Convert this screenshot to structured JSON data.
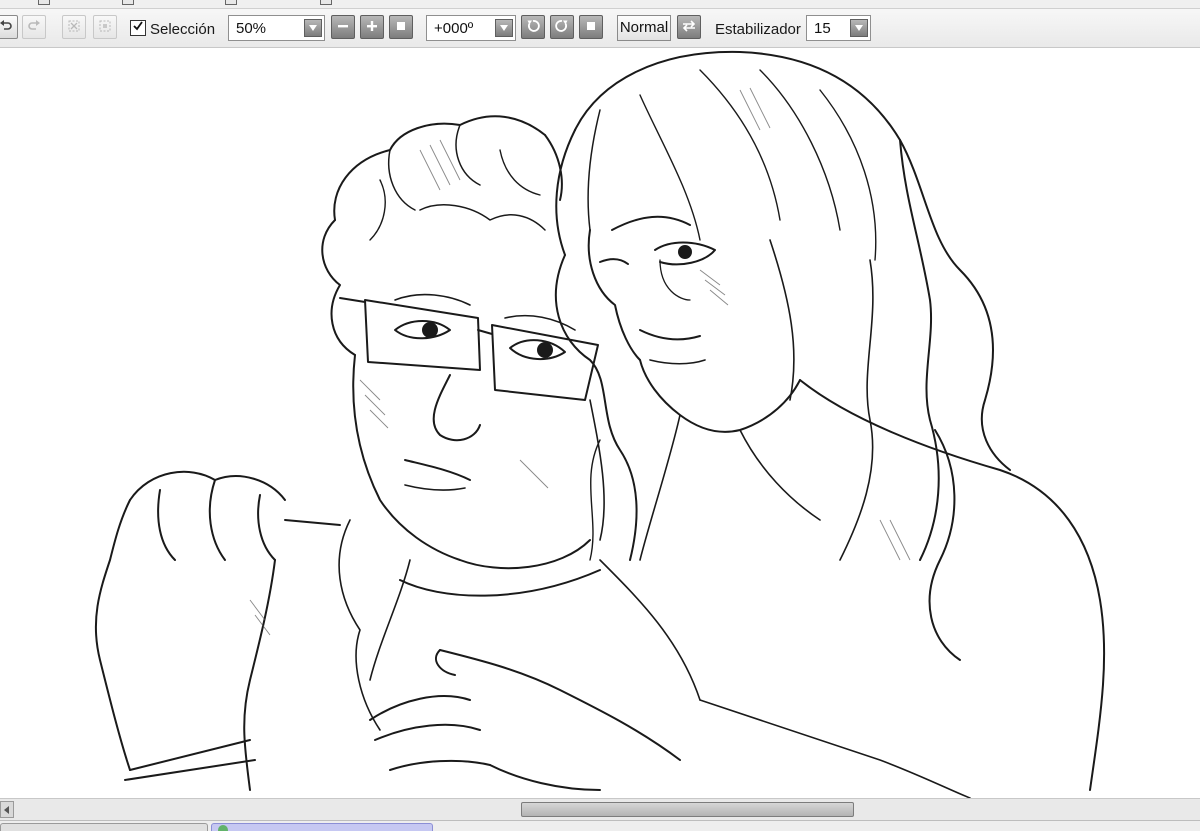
{
  "toolbar": {
    "selection_checkbox": {
      "label": "Selección",
      "checked": true
    },
    "zoom": {
      "value": "50%"
    },
    "rotation": {
      "value": "+000º"
    },
    "blend_mode": {
      "label": "Normal"
    },
    "stabilizer": {
      "label": "Estabilizador",
      "value": "15"
    },
    "icons": {
      "undo": "undo-icon",
      "redo": "redo-icon",
      "deselect": "deselect-icon",
      "invert_selection": "invert-selection-icon",
      "zoom_out": "minus-icon",
      "zoom_in": "plus-icon",
      "zoom_reset": "square-icon",
      "rotate_left": "rotate-left-icon",
      "rotate_right": "rotate-right-icon",
      "rotate_reset": "square-icon",
      "flip": "flip-horizontal-icon",
      "dropdown": "chevron-down-icon"
    }
  },
  "canvas": {
    "description_icon": "line-art-drawing",
    "stroke_color": "#1a1a1a",
    "background_color": "#ffffff"
  },
  "scrollbar": {
    "horizontal_position_fraction": 0.43,
    "visible_fraction": 0.28
  },
  "tabs": [
    {
      "label": "",
      "active": false
    },
    {
      "label": "",
      "active": true
    }
  ]
}
